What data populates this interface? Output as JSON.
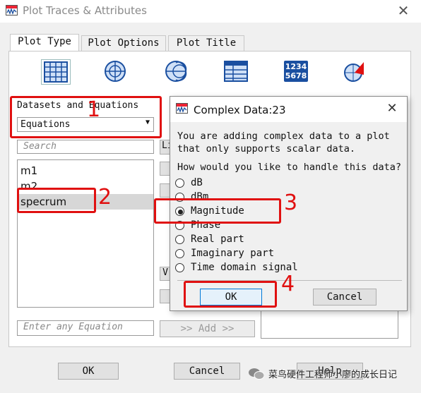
{
  "window": {
    "title": "Plot Traces & Attributes",
    "close_glyph": "✕"
  },
  "tabs": [
    "Plot Type",
    "Plot Options",
    "Plot Title"
  ],
  "plot_type_icons": [
    "rectangular-plot-icon",
    "polar-plot-icon",
    "smith-chart-icon",
    "list-table-icon",
    "numeric-table-icon",
    "antenna-plot-icon"
  ],
  "numeric_icon_text": {
    "line1": "1234",
    "line2": "5678"
  },
  "datasets": {
    "label": "Datasets and Equations",
    "combo_value": "Equations",
    "search_placeholder": "Search",
    "items": [
      "m1",
      "m2",
      "specrum"
    ],
    "equation_placeholder": "Enter any Equation",
    "add_button": ">> Add >>",
    "partial_btn_1": "Li",
    "partial_btn_2": "V"
  },
  "bottom_buttons": {
    "ok": "OK",
    "cancel": "Cancel",
    "help": "Help"
  },
  "dialog": {
    "title": "Complex Data:23",
    "message_line1": "You are adding complex data to a plot",
    "message_line2": "that only supports scalar data.",
    "question": "How would you like to handle this data?",
    "options": [
      "dB",
      "dBm",
      "Magnitude",
      "Phase",
      "Real part",
      "Imaginary part",
      "Time domain signal"
    ],
    "selected": "Magnitude",
    "ok": "OK",
    "cancel": "Cancel"
  },
  "annotations": [
    "1",
    "2",
    "3",
    "4"
  ],
  "watermark": "菜鸟硬件工程师小廖的成长日记",
  "colors": {
    "annotation_red": "#e01010",
    "icon_blue": "#1a4fa0"
  }
}
